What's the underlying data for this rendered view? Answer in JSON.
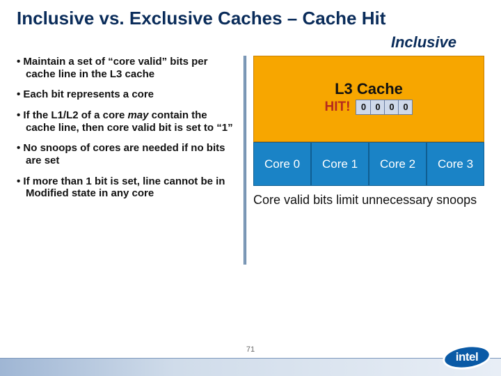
{
  "title": "Inclusive vs. Exclusive Caches – Cache Hit",
  "subtitle": "Inclusive",
  "bullets": [
    "Maintain a set of “core valid” bits per cache line in the L3 cache",
    "Each bit represents a core",
    "If the L1/L2 of a core may contain the cache line, then core valid bit is set to “1”",
    "No snoops of cores are needed if no bits are set",
    "If more than 1 bit is set, line cannot be in Modified state in any core"
  ],
  "diagram": {
    "l3_label": "L3 Cache",
    "hit_label": "HIT!",
    "valid_bits": [
      "0",
      "0",
      "0",
      "0"
    ],
    "cores": [
      "Core 0",
      "Core 1",
      "Core 2",
      "Core 3"
    ]
  },
  "caption": "Core valid bits limit unnecessary snoops",
  "page_number": "71",
  "logo_text": "intel"
}
